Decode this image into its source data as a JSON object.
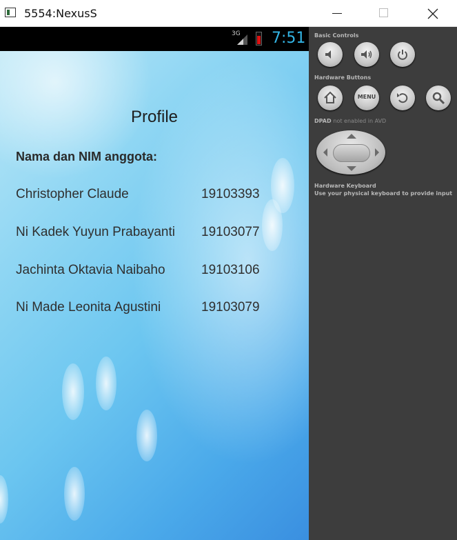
{
  "window": {
    "title": "5554:NexusS",
    "icon": "emulator-icon",
    "controls": [
      "minimize-icon",
      "maximize-icon",
      "close-icon"
    ]
  },
  "statusbar": {
    "network": "3G",
    "time": "7:51",
    "time_color": "#33b5e5",
    "battery_color": "#dd1111"
  },
  "app": {
    "title": "Profile",
    "members_label": "Nama dan NIM anggota:",
    "members": [
      {
        "name": "Christopher Claude",
        "nim": "19103393"
      },
      {
        "name": "Ni Kadek Yuyun Prabayanti",
        "nim": "19103077"
      },
      {
        "name": "Jachinta Oktavia Naibaho",
        "nim": "19103106"
      },
      {
        "name": "Ni Made Leonita Agustini",
        "nim": "19103079"
      }
    ]
  },
  "panel": {
    "basic_controls_label": "Basic Controls",
    "basic_controls": [
      "volume-down-icon",
      "volume-up-icon",
      "power-icon"
    ],
    "hardware_buttons_label": "Hardware Buttons",
    "hardware_buttons": [
      "home-icon",
      "menu",
      "back-icon",
      "search-icon"
    ],
    "menu_label": "MENU",
    "dpad_label": "DPAD",
    "dpad_note": "not enabled in AVD",
    "keyboard_label": "Hardware Keyboard",
    "keyboard_note": "Use your physical keyboard to provide input"
  },
  "colors": {
    "panel_bg": "#3d3d3d",
    "status_bar_bg": "#000000"
  }
}
